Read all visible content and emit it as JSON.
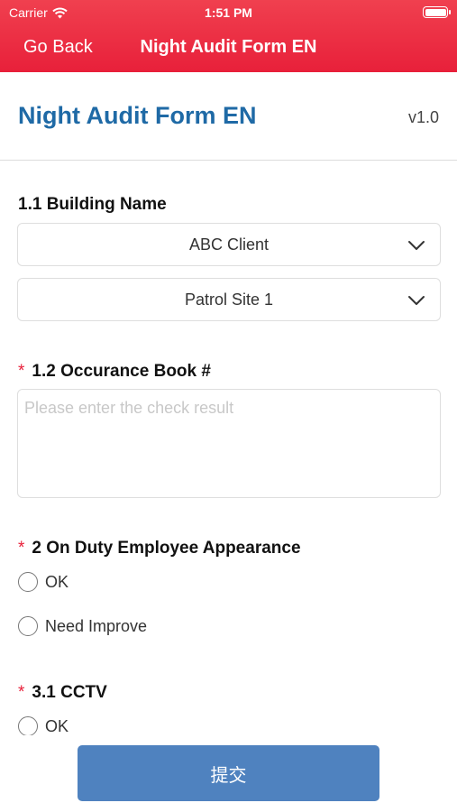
{
  "status_bar": {
    "carrier": "Carrier",
    "time": "1:51 PM"
  },
  "nav": {
    "back_label": "Go Back",
    "title": "Night Audit Form EN"
  },
  "form": {
    "title": "Night Audit Form EN",
    "version": "v1.0",
    "building": {
      "label": "1.1 Building Name",
      "client_value": "ABC Client",
      "site_value": "Patrol Site 1"
    },
    "occurance": {
      "required_mark": "*",
      "label": "1.2 Occurance Book #",
      "placeholder": "Please enter the check result"
    },
    "appearance": {
      "required_mark": "*",
      "label": "2 On Duty Employee Appearance",
      "options": [
        "OK",
        "Need Improve"
      ]
    },
    "cctv": {
      "required_mark": "*",
      "label": "3.1 CCTV",
      "options": [
        "OK"
      ]
    },
    "submit_label": "提交"
  },
  "colors": {
    "header_red": "#e8203a",
    "title_blue": "#1f6aa6",
    "submit_blue": "#4f82bf"
  }
}
